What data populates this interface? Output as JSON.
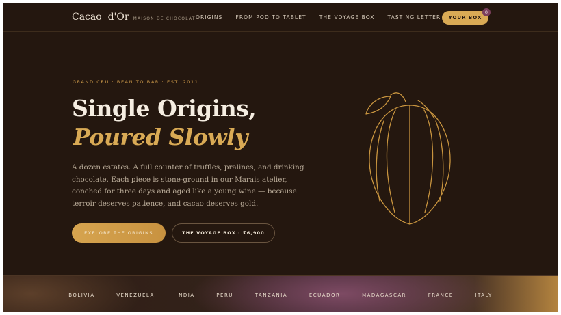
{
  "brand": {
    "name": "Cacao",
    "name_suffix": "d'Or",
    "tagline": "MAISON DE CHOCOLAT"
  },
  "nav": {
    "links": [
      "ORIGINS",
      "FROM POD TO TABLET",
      "THE VOYAGE BOX",
      "TASTING LETTER"
    ],
    "box_label": "YOUR BOX",
    "box_count": "0"
  },
  "hero": {
    "eyebrow": "GRAND CRU · BEAN TO BAR · EST. 2011",
    "title_line1": "Single Origins,",
    "title_line2": "Poured Slowly",
    "lede": "A dozen estates. A full counter of truffles, pralines, and drinking chocolate. Each piece is stone-ground in our Marais atelier, conched for three days and aged like a young wine — because terroir deserves patience, and cacao deserves gold.",
    "cta_primary": "EXPLORE THE ORIGINS",
    "cta_secondary": "THE VOYAGE BOX · ₹6,900",
    "illustration_icon": "cacao-pod-icon"
  },
  "origins": [
    "BOLIVIA",
    "VENEZUELA",
    "INDIA",
    "PERU",
    "TANZANIA",
    "ECUADOR",
    "MADAGASCAR",
    "FRANCE",
    "ITALY"
  ],
  "colors": {
    "background": "#24170f",
    "gold": "#d9aa55",
    "cream": "#f5ede1",
    "badge": "#7b3f5c"
  }
}
